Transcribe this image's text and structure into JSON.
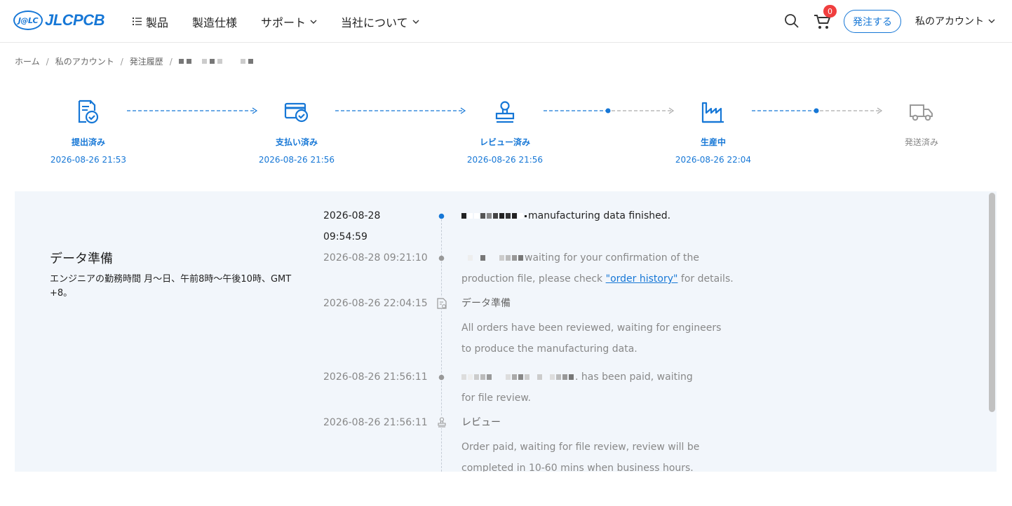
{
  "header": {
    "logo_badge": "J@LC",
    "logo_text": "JLCPCB",
    "nav": [
      {
        "label": "製品"
      },
      {
        "label": "製造仕様"
      },
      {
        "label": "サポート"
      },
      {
        "label": "当社について"
      }
    ],
    "cart_count": "0",
    "order_button": "発注する",
    "account": "私のアカウント"
  },
  "breadcrumb": {
    "items": [
      "ホーム",
      "私のアカウント",
      "発注履歴"
    ],
    "separator": "/"
  },
  "steps": [
    {
      "label": "提出済み",
      "time": "2026-08-26 21:53",
      "icon": "document-check-icon"
    },
    {
      "label": "支払い済み",
      "time": "2026-08-26 21:56",
      "icon": "card-check-icon"
    },
    {
      "label": "レビュー済み",
      "time": "2026-08-26 21:56",
      "icon": "stamp-icon"
    },
    {
      "label": "生産中",
      "time": "2026-08-26 22:04",
      "icon": "factory-icon"
    },
    {
      "label": "発送済み",
      "time": "",
      "icon": "truck-icon"
    }
  ],
  "panel": {
    "title": "データ準備",
    "description": "エンジニアの勤務時間 月～日、午前8時～午後10時、GMT +8。"
  },
  "timeline": {
    "e1": {
      "date": "2026-08-28",
      "time": "09:54:59",
      "text": "manufacturing data finished."
    },
    "e2": {
      "time": "2026-08-28 09:21:10",
      "text_a": "waiting for your confirmation of the",
      "text_b": "production file, please check",
      "link": "\"order history\"",
      "text_c": "for details."
    },
    "e3": {
      "time": "2026-08-26 22:04:15",
      "head": "データ準備",
      "text": "All orders have been reviewed, waiting for engineers to produce the manufacturing data."
    },
    "e4": {
      "time": "2026-08-26 21:56:11",
      "text_a": ". has been paid, waiting",
      "text_b": "for file review."
    },
    "e5": {
      "time": "2026-08-26 21:56:11",
      "head": "レビュー",
      "text": "Order paid, waiting for file review, review will be completed in 10-60 mins when business hours."
    }
  },
  "colors": {
    "accent": "#1677d6",
    "badge": "#f03e3e",
    "panel_bg": "#f2f6fb"
  }
}
